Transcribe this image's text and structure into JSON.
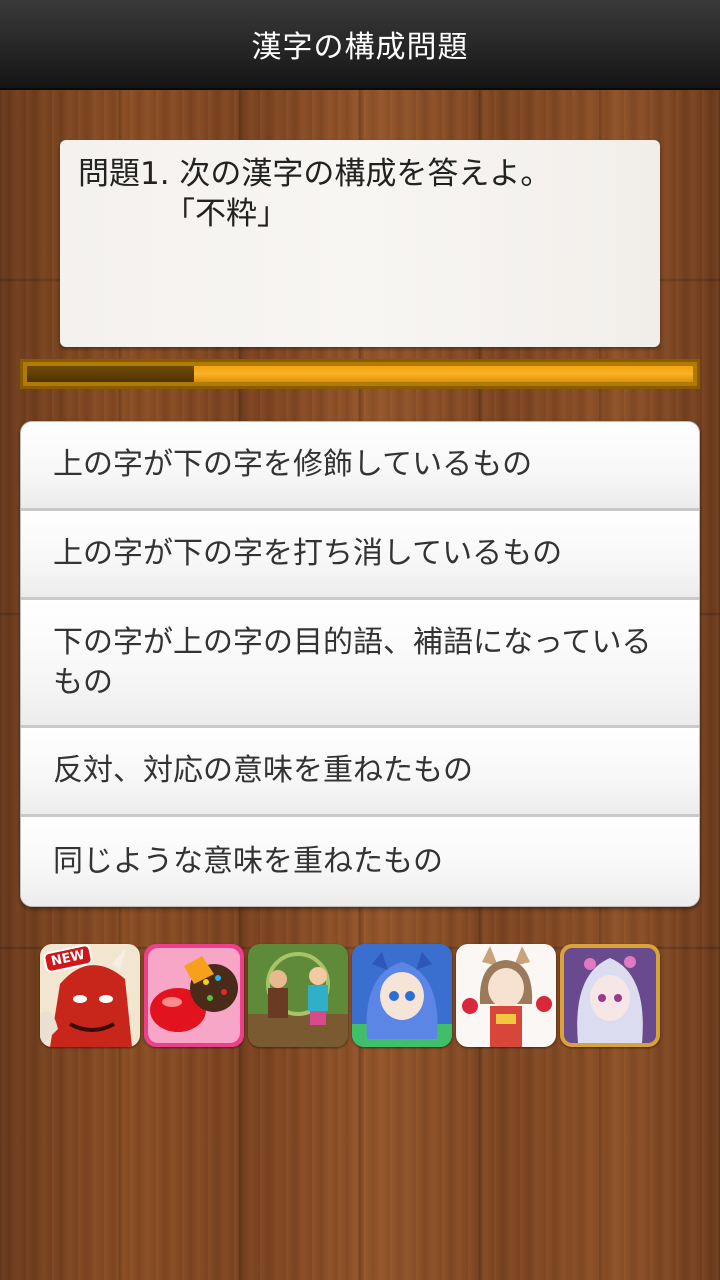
{
  "header": {
    "title": "漢字の構成問題"
  },
  "question": {
    "line1": "問題1. 次の漢字の構成を答えよ。",
    "line2": "「不粋」"
  },
  "timer": {
    "elapsed_fraction": 0.25
  },
  "choices": [
    {
      "label": "上の字が下の字を修飾しているもの"
    },
    {
      "label": "上の字が下の字を打ち消しているもの"
    },
    {
      "label": "下の字が上の字の目的語、補語になっているもの"
    },
    {
      "label": "反対、対応の意味を重ねたもの"
    },
    {
      "label": "同じような意味を重ねたもの"
    }
  ],
  "ads": [
    {
      "icon": "demon-game-icon",
      "badge": "NEW"
    },
    {
      "icon": "candy-game-icon"
    },
    {
      "icon": "adventure-game-icon"
    },
    {
      "icon": "blue-girl-game-icon"
    },
    {
      "icon": "fox-girl-game-icon"
    },
    {
      "icon": "silver-hair-game-icon"
    }
  ]
}
